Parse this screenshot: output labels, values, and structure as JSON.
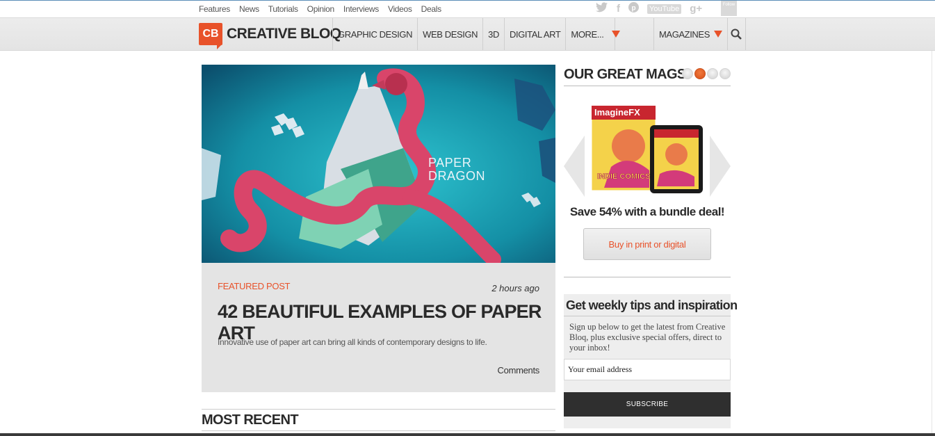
{
  "topbar": {
    "links": [
      "Features",
      "News",
      "Tutorials",
      "Opinion",
      "Interviews",
      "Videos",
      "Deals"
    ],
    "social": {
      "twitter": "twitter-icon",
      "facebook": "f",
      "pinterest": "pinterest-icon",
      "youtube_1": "You",
      "youtube_2": "Tube",
      "googleplus": "g+",
      "follow": "Follow"
    }
  },
  "nav": {
    "logo_mark": "CB",
    "logo_text": "CREATIVE BLOQ",
    "items": [
      "GRAPHIC DESIGN",
      "WEB DESIGN",
      "3D",
      "DIGITAL ART"
    ],
    "more": "MORE...",
    "magazines": "MAGAZINES",
    "accent": "#e8522a"
  },
  "featured": {
    "image_text_1": "PAPER",
    "image_text_2": "DRAGON",
    "label": "FEATURED POST",
    "time": "2 hours ago",
    "title": "42 BEAUTIFUL EXAMPLES OF PAPER ART",
    "description": "Innovative use of paper art can bring all kinds of contemporary designs to life.",
    "comments": "Comments"
  },
  "most_recent": "MOST RECENT",
  "sidebar": {
    "mags_title": "OUR GREAT MAGS",
    "carousel_active_index": 1,
    "cover_masthead": "ImagineFX",
    "cover_headline": "INDIE COMICS",
    "save_text": "Save 54% with a bundle deal!",
    "buy_button": "Buy in print or digital",
    "newsletter": {
      "title": "Get weekly tips and inspiration",
      "description": "Sign up below to get the latest from Creative Bloq, plus exclusive special offers, direct to your inbox!",
      "placeholder": "Your email address",
      "button": "SUBSCRIBE"
    }
  }
}
